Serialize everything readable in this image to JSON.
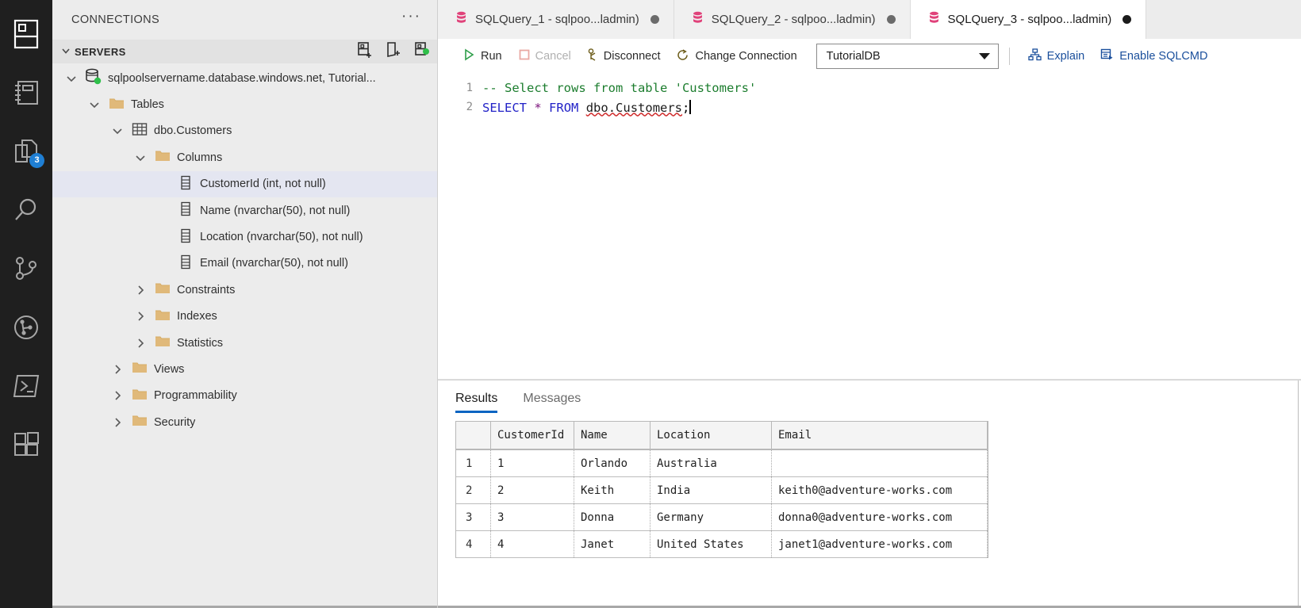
{
  "activitybar": {
    "items": [
      {
        "name": "connections-icon",
        "title": "Connections"
      },
      {
        "name": "notebooks-icon",
        "title": "Notebooks"
      },
      {
        "name": "open-editors-icon",
        "title": "Open Editors",
        "badge": "3"
      },
      {
        "name": "search-icon",
        "title": "Search"
      },
      {
        "name": "source-control-icon",
        "title": "Source Control"
      },
      {
        "name": "query-history-icon",
        "title": "Query History"
      },
      {
        "name": "terminal-icon",
        "title": "Terminal"
      },
      {
        "name": "extensions-icon",
        "title": "Extensions"
      }
    ]
  },
  "sidebar": {
    "title": "CONNECTIONS",
    "more_label": "···",
    "section": {
      "label": "SERVERS",
      "expanded": true,
      "actions": [
        {
          "name": "new-connection-icon",
          "title": "New Connection"
        },
        {
          "name": "new-server-group-icon",
          "title": "New Server Group"
        },
        {
          "name": "refresh-servers-icon",
          "title": "Refresh"
        }
      ]
    },
    "tree": [
      {
        "label": "sqlpoolservername.database.windows.net, Tutorial...",
        "indent": 1,
        "twisty": "down",
        "icon": "server-icon",
        "selected": false
      },
      {
        "label": "Tables",
        "indent": 2,
        "twisty": "down",
        "icon": "folder-icon",
        "selected": false
      },
      {
        "label": "dbo.Customers",
        "indent": 3,
        "twisty": "down",
        "icon": "table-icon",
        "selected": false
      },
      {
        "label": "Columns",
        "indent": 4,
        "twisty": "down",
        "icon": "folder-icon",
        "selected": false
      },
      {
        "label": "CustomerId (int, not null)",
        "indent": 5,
        "twisty": "none",
        "icon": "column-icon",
        "selected": true
      },
      {
        "label": "Name (nvarchar(50), not null)",
        "indent": 5,
        "twisty": "none",
        "icon": "column-icon",
        "selected": false
      },
      {
        "label": "Location (nvarchar(50), not null)",
        "indent": 5,
        "twisty": "none",
        "icon": "column-icon",
        "selected": false
      },
      {
        "label": "Email (nvarchar(50), not null)",
        "indent": 5,
        "twisty": "none",
        "icon": "column-icon",
        "selected": false
      },
      {
        "label": "Constraints",
        "indent": 4,
        "twisty": "right",
        "icon": "folder-icon",
        "selected": false
      },
      {
        "label": "Indexes",
        "indent": 4,
        "twisty": "right",
        "icon": "folder-icon",
        "selected": false
      },
      {
        "label": "Statistics",
        "indent": 4,
        "twisty": "right",
        "icon": "folder-icon",
        "selected": false
      },
      {
        "label": "Views",
        "indent": 3,
        "twisty": "right",
        "icon": "folder-icon",
        "selected": false
      },
      {
        "label": "Programmability",
        "indent": 3,
        "twisty": "right",
        "icon": "folder-icon",
        "selected": false
      },
      {
        "label": "Security",
        "indent": 3,
        "twisty": "right",
        "icon": "folder-icon",
        "selected": false
      }
    ]
  },
  "tabs": [
    {
      "label": "SQLQuery_1 - sqlpoo...ladmin)",
      "active": false,
      "dirty": true
    },
    {
      "label": "SQLQuery_2 - sqlpoo...ladmin)",
      "active": false,
      "dirty": true
    },
    {
      "label": "SQLQuery_3 - sqlpoo...ladmin)",
      "active": true,
      "dirty": true
    }
  ],
  "toolbar": {
    "run_label": "Run",
    "cancel_label": "Cancel",
    "disconnect_label": "Disconnect",
    "change_connection_label": "Change Connection",
    "database_value": "TutorialDB",
    "explain_label": "Explain",
    "enable_sqlcmd_label": "Enable SQLCMD"
  },
  "editor": {
    "lines": [
      {
        "number": "1",
        "comment": "-- Select rows from table 'Customers'"
      },
      {
        "number": "2",
        "kw1": "SELECT",
        "op": "*",
        "kw2": "FROM",
        "ident": "dbo.Customers",
        "tail": ";"
      }
    ]
  },
  "results_panel": {
    "tabs": [
      {
        "label": "Results",
        "active": true
      },
      {
        "label": "Messages",
        "active": false
      }
    ],
    "grid": {
      "rownum_header": "",
      "columns": [
        "CustomerId",
        "Name",
        "Location",
        "Email"
      ],
      "rows": [
        {
          "n": "1",
          "cells": [
            "1",
            "Orlando",
            "Australia",
            ""
          ]
        },
        {
          "n": "2",
          "cells": [
            "2",
            "Keith",
            "India",
            "keith0@adventure-works.com"
          ]
        },
        {
          "n": "3",
          "cells": [
            "3",
            "Donna",
            "Germany",
            "donna0@adventure-works.com"
          ]
        },
        {
          "n": "4",
          "cells": [
            "4",
            "Janet",
            "United States",
            "janet1@adventure-works.com"
          ]
        }
      ]
    }
  },
  "colors": {
    "activitybar_bg": "#1f1f1f",
    "sidebar_bg": "#ececec",
    "accent_blue": "#0a64c2",
    "badge_blue": "#1f7fd4",
    "tab_db_icon": "#e0427a",
    "folder": "#e0b97a",
    "connected_green": "#2fbf4a",
    "comment_green": "#1c7d2e",
    "keyword_blue": "#2222c7",
    "selection": "#e4e6f1"
  }
}
